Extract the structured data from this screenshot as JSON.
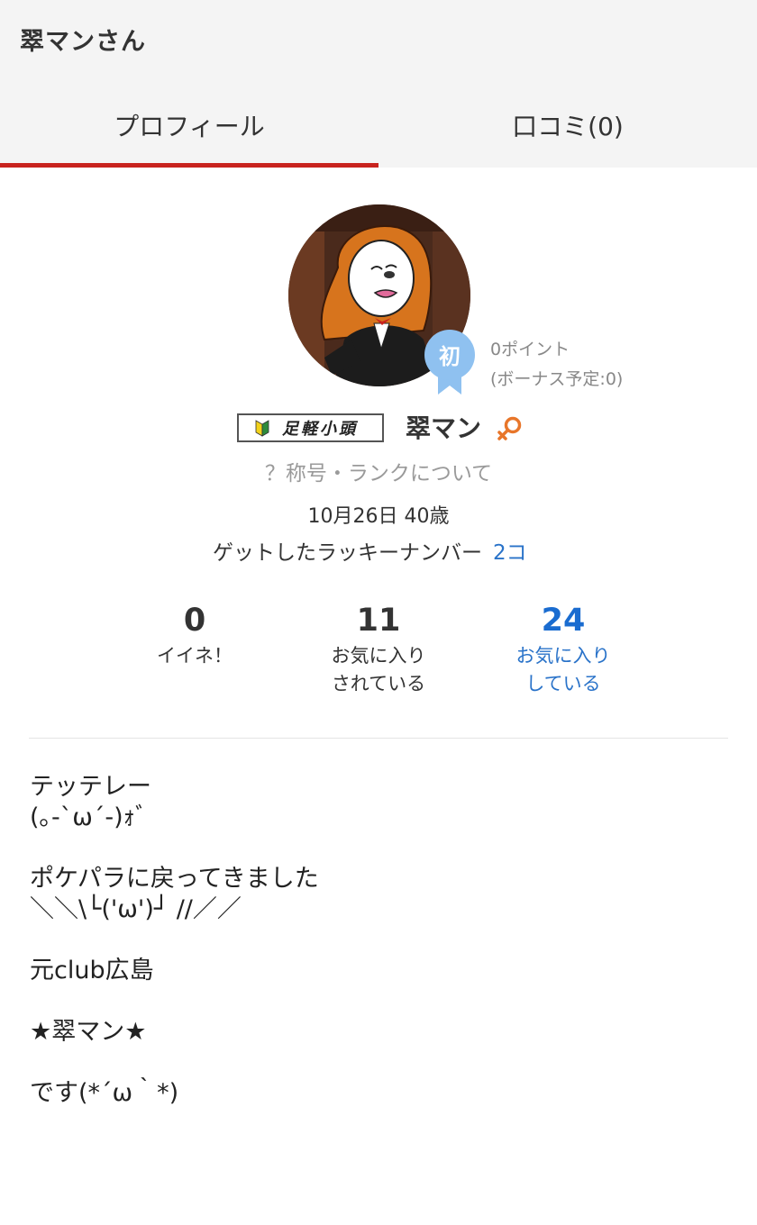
{
  "header": {
    "title": "翠マンさん"
  },
  "tabs": [
    {
      "label": "プロフィール",
      "active": true
    },
    {
      "label": "口コミ(0)",
      "active": false
    }
  ],
  "profile": {
    "rank_badge_text": "初",
    "points_line1": "0ポイント",
    "points_line2": "(ボーナス予定:0)",
    "title_badge_text": "足軽小頭",
    "user_name": "翠マン",
    "gender_icon": "female-icon",
    "rank_link": "？称号・ランクについて",
    "birthday_age": "10月26日 40歳",
    "lucky_label": "ゲットしたラッキーナンバー",
    "lucky_count": "2コ"
  },
  "stats": [
    {
      "value": "0",
      "label": "イイネ！"
    },
    {
      "value": "11",
      "label": "お気に入り\nされている"
    },
    {
      "value": "24",
      "label": "お気に入り\nしている"
    }
  ],
  "bio": {
    "lines": [
      "テッテレー",
      "(｡-`ω´-)ｫﾞ",
      "",
      "ポケパラに戻ってきました",
      "＼＼\\└('ω')┘ //／／",
      "",
      "元club広島",
      "",
      "★翠マン★",
      "",
      "です(*´ω｀*)"
    ]
  },
  "colors": {
    "accent_red": "#c8231e",
    "link_blue": "#2a73c9",
    "badge_blue": "#8fc1f0",
    "female_orange": "#e8762a"
  }
}
